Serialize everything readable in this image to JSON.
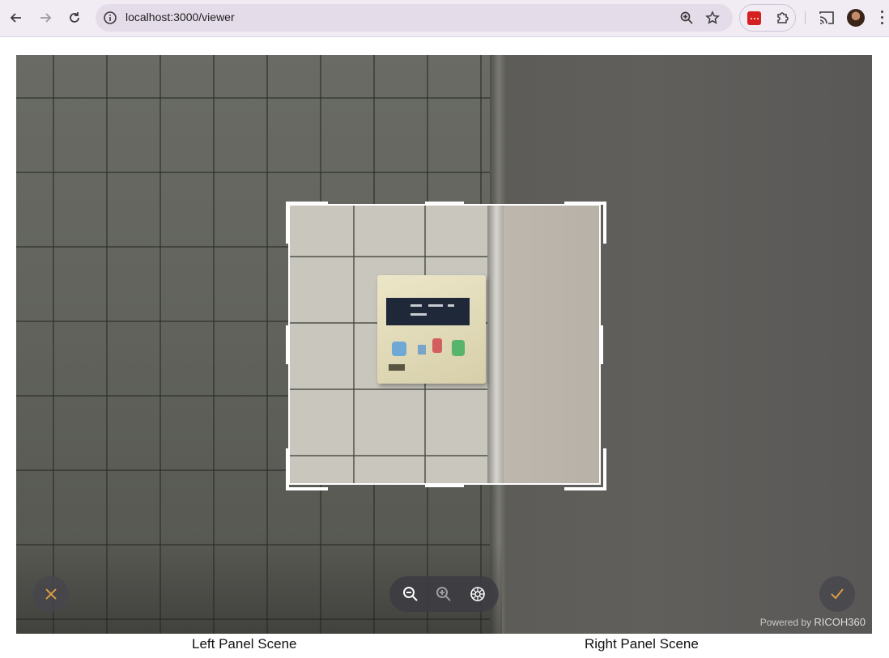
{
  "browser": {
    "url": "localhost:3000/viewer",
    "icons": [
      "back-icon",
      "forward-icon",
      "reload-icon",
      "site-info-icon",
      "zoom-icon",
      "bookmark-star-icon",
      "extension-icon",
      "puzzle-icon",
      "cast-icon",
      "profile-avatar",
      "more-icon"
    ]
  },
  "viewer": {
    "powered_prefix": "Powered by",
    "powered_brand": "RICOH360",
    "accent_color": "#e8a243"
  },
  "captions": {
    "left": "Left Panel Scene",
    "right": "Right Panel Scene"
  }
}
